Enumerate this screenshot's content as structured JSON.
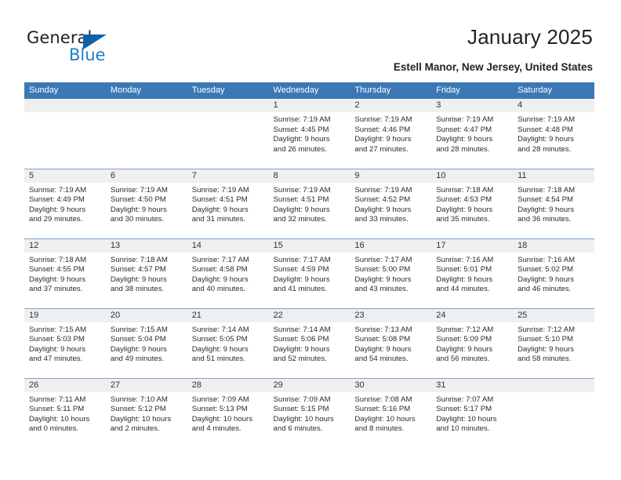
{
  "brand": {
    "name_top": "General",
    "name_bottom": "Blue",
    "accent_color": "#1e7fc4",
    "triangle_color": "#0f62a8"
  },
  "header": {
    "title": "January 2025",
    "location": "Estell Manor, New Jersey, United States"
  },
  "theme": {
    "header_blue": "#3b78b5",
    "daynum_gray": "#efefef",
    "rule_color": "#7aa3cc"
  },
  "columns": [
    "Sunday",
    "Monday",
    "Tuesday",
    "Wednesday",
    "Thursday",
    "Friday",
    "Saturday"
  ],
  "weeks": [
    [
      {
        "day": "",
        "empty": true
      },
      {
        "day": "",
        "empty": true
      },
      {
        "day": "",
        "empty": true
      },
      {
        "day": "1",
        "sunrise": "Sunrise: 7:19 AM",
        "sunset": "Sunset: 4:45 PM",
        "daylight1": "Daylight: 9 hours",
        "daylight2": "and 26 minutes."
      },
      {
        "day": "2",
        "sunrise": "Sunrise: 7:19 AM",
        "sunset": "Sunset: 4:46 PM",
        "daylight1": "Daylight: 9 hours",
        "daylight2": "and 27 minutes."
      },
      {
        "day": "3",
        "sunrise": "Sunrise: 7:19 AM",
        "sunset": "Sunset: 4:47 PM",
        "daylight1": "Daylight: 9 hours",
        "daylight2": "and 28 minutes."
      },
      {
        "day": "4",
        "sunrise": "Sunrise: 7:19 AM",
        "sunset": "Sunset: 4:48 PM",
        "daylight1": "Daylight: 9 hours",
        "daylight2": "and 28 minutes."
      }
    ],
    [
      {
        "day": "5",
        "sunrise": "Sunrise: 7:19 AM",
        "sunset": "Sunset: 4:49 PM",
        "daylight1": "Daylight: 9 hours",
        "daylight2": "and 29 minutes."
      },
      {
        "day": "6",
        "sunrise": "Sunrise: 7:19 AM",
        "sunset": "Sunset: 4:50 PM",
        "daylight1": "Daylight: 9 hours",
        "daylight2": "and 30 minutes."
      },
      {
        "day": "7",
        "sunrise": "Sunrise: 7:19 AM",
        "sunset": "Sunset: 4:51 PM",
        "daylight1": "Daylight: 9 hours",
        "daylight2": "and 31 minutes."
      },
      {
        "day": "8",
        "sunrise": "Sunrise: 7:19 AM",
        "sunset": "Sunset: 4:51 PM",
        "daylight1": "Daylight: 9 hours",
        "daylight2": "and 32 minutes."
      },
      {
        "day": "9",
        "sunrise": "Sunrise: 7:19 AM",
        "sunset": "Sunset: 4:52 PM",
        "daylight1": "Daylight: 9 hours",
        "daylight2": "and 33 minutes."
      },
      {
        "day": "10",
        "sunrise": "Sunrise: 7:18 AM",
        "sunset": "Sunset: 4:53 PM",
        "daylight1": "Daylight: 9 hours",
        "daylight2": "and 35 minutes."
      },
      {
        "day": "11",
        "sunrise": "Sunrise: 7:18 AM",
        "sunset": "Sunset: 4:54 PM",
        "daylight1": "Daylight: 9 hours",
        "daylight2": "and 36 minutes."
      }
    ],
    [
      {
        "day": "12",
        "sunrise": "Sunrise: 7:18 AM",
        "sunset": "Sunset: 4:55 PM",
        "daylight1": "Daylight: 9 hours",
        "daylight2": "and 37 minutes."
      },
      {
        "day": "13",
        "sunrise": "Sunrise: 7:18 AM",
        "sunset": "Sunset: 4:57 PM",
        "daylight1": "Daylight: 9 hours",
        "daylight2": "and 38 minutes."
      },
      {
        "day": "14",
        "sunrise": "Sunrise: 7:17 AM",
        "sunset": "Sunset: 4:58 PM",
        "daylight1": "Daylight: 9 hours",
        "daylight2": "and 40 minutes."
      },
      {
        "day": "15",
        "sunrise": "Sunrise: 7:17 AM",
        "sunset": "Sunset: 4:59 PM",
        "daylight1": "Daylight: 9 hours",
        "daylight2": "and 41 minutes."
      },
      {
        "day": "16",
        "sunrise": "Sunrise: 7:17 AM",
        "sunset": "Sunset: 5:00 PM",
        "daylight1": "Daylight: 9 hours",
        "daylight2": "and 43 minutes."
      },
      {
        "day": "17",
        "sunrise": "Sunrise: 7:16 AM",
        "sunset": "Sunset: 5:01 PM",
        "daylight1": "Daylight: 9 hours",
        "daylight2": "and 44 minutes."
      },
      {
        "day": "18",
        "sunrise": "Sunrise: 7:16 AM",
        "sunset": "Sunset: 5:02 PM",
        "daylight1": "Daylight: 9 hours",
        "daylight2": "and 46 minutes."
      }
    ],
    [
      {
        "day": "19",
        "sunrise": "Sunrise: 7:15 AM",
        "sunset": "Sunset: 5:03 PM",
        "daylight1": "Daylight: 9 hours",
        "daylight2": "and 47 minutes."
      },
      {
        "day": "20",
        "sunrise": "Sunrise: 7:15 AM",
        "sunset": "Sunset: 5:04 PM",
        "daylight1": "Daylight: 9 hours",
        "daylight2": "and 49 minutes."
      },
      {
        "day": "21",
        "sunrise": "Sunrise: 7:14 AM",
        "sunset": "Sunset: 5:05 PM",
        "daylight1": "Daylight: 9 hours",
        "daylight2": "and 51 minutes."
      },
      {
        "day": "22",
        "sunrise": "Sunrise: 7:14 AM",
        "sunset": "Sunset: 5:06 PM",
        "daylight1": "Daylight: 9 hours",
        "daylight2": "and 52 minutes."
      },
      {
        "day": "23",
        "sunrise": "Sunrise: 7:13 AM",
        "sunset": "Sunset: 5:08 PM",
        "daylight1": "Daylight: 9 hours",
        "daylight2": "and 54 minutes."
      },
      {
        "day": "24",
        "sunrise": "Sunrise: 7:12 AM",
        "sunset": "Sunset: 5:09 PM",
        "daylight1": "Daylight: 9 hours",
        "daylight2": "and 56 minutes."
      },
      {
        "day": "25",
        "sunrise": "Sunrise: 7:12 AM",
        "sunset": "Sunset: 5:10 PM",
        "daylight1": "Daylight: 9 hours",
        "daylight2": "and 58 minutes."
      }
    ],
    [
      {
        "day": "26",
        "sunrise": "Sunrise: 7:11 AM",
        "sunset": "Sunset: 5:11 PM",
        "daylight1": "Daylight: 10 hours",
        "daylight2": "and 0 minutes."
      },
      {
        "day": "27",
        "sunrise": "Sunrise: 7:10 AM",
        "sunset": "Sunset: 5:12 PM",
        "daylight1": "Daylight: 10 hours",
        "daylight2": "and 2 minutes."
      },
      {
        "day": "28",
        "sunrise": "Sunrise: 7:09 AM",
        "sunset": "Sunset: 5:13 PM",
        "daylight1": "Daylight: 10 hours",
        "daylight2": "and 4 minutes."
      },
      {
        "day": "29",
        "sunrise": "Sunrise: 7:09 AM",
        "sunset": "Sunset: 5:15 PM",
        "daylight1": "Daylight: 10 hours",
        "daylight2": "and 6 minutes."
      },
      {
        "day": "30",
        "sunrise": "Sunrise: 7:08 AM",
        "sunset": "Sunset: 5:16 PM",
        "daylight1": "Daylight: 10 hours",
        "daylight2": "and 8 minutes."
      },
      {
        "day": "31",
        "sunrise": "Sunrise: 7:07 AM",
        "sunset": "Sunset: 5:17 PM",
        "daylight1": "Daylight: 10 hours",
        "daylight2": "and 10 minutes."
      },
      {
        "day": "",
        "empty": true
      }
    ]
  ]
}
